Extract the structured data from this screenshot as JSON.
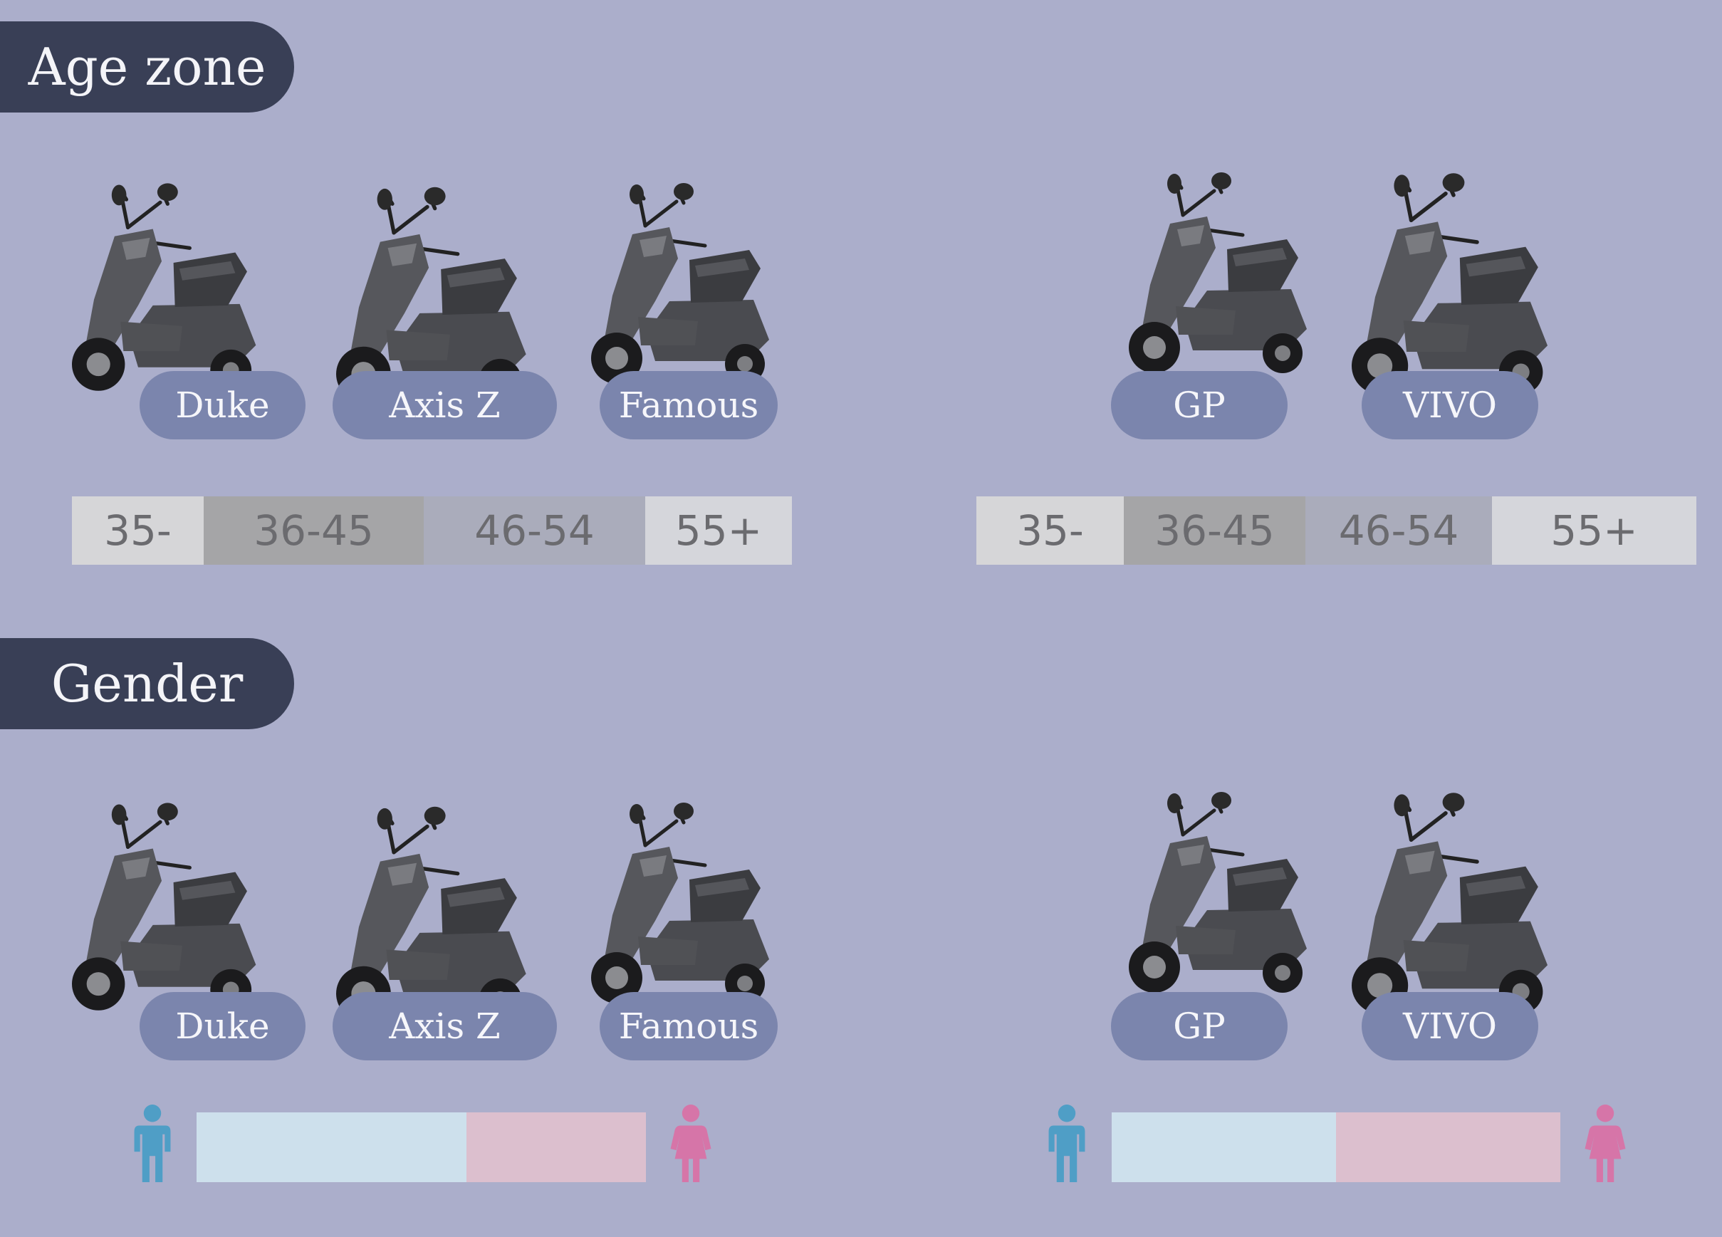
{
  "sections": {
    "age_title": "Age zone",
    "gender_title": "Gender"
  },
  "models": {
    "duke": "Duke",
    "axis_z": "Axis Z",
    "famous": "Famous",
    "gp": "GP",
    "vivo": "VIVO"
  },
  "age_groups": {
    "a": "35-",
    "b": "36-45",
    "c": "46-54",
    "d": "55+"
  },
  "gender_split": {
    "left_male_share": 0.6,
    "right_male_share": 0.5
  },
  "colors": {
    "background": "#abaecb",
    "section_pill": "#393f56",
    "name_pill": "#7b85ad",
    "age_seg_1": "#d6d6d8",
    "age_seg_2": "#a5a5a7",
    "age_seg_3": "#aaacbb",
    "age_seg_4": "#d5d6db",
    "male": "#4f9ec6",
    "female": "#d675a8",
    "male_bar": "#cde0ec",
    "female_bar": "#dcbfce"
  },
  "icons": {
    "scooter": "scooter-icon",
    "male": "male-person-icon",
    "female": "female-person-icon"
  }
}
